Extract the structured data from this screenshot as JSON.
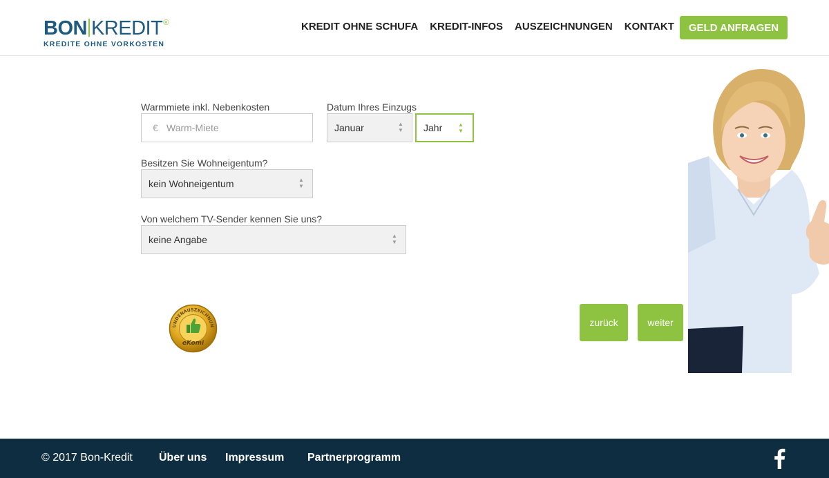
{
  "header": {
    "logo": {
      "bon": "BON",
      "kredit": "KREDIT",
      "registered": "®",
      "tagline": "KREDITE OHNE VORKOSTEN"
    },
    "nav": [
      {
        "label": "KREDIT OHNE SCHUFA"
      },
      {
        "label": "KREDIT-INFOS"
      },
      {
        "label": "AUSZEICHNUNGEN"
      },
      {
        "label": "KONTAKT"
      }
    ],
    "cta": "GELD ANFRAGEN"
  },
  "form": {
    "warmmiete": {
      "label": "Warmmiete inkl. Nebenkosten",
      "currency": "€",
      "placeholder": "Warm-Miete",
      "value": ""
    },
    "einzug": {
      "label": "Datum Ihres Einzugs",
      "month": "Januar",
      "year": "Jahr"
    },
    "eigentum": {
      "label": "Besitzen Sie Wohneigentum?",
      "value": "kein Wohneigentum"
    },
    "tv": {
      "label": "Von welchem TV-Sender kennen Sie uns?",
      "value": "keine Angabe"
    },
    "back": "zurück",
    "next": "weiter"
  },
  "badge": {
    "top_text": "KUNDENAUSZEICHNUNG",
    "bottom_text": "eKomi"
  },
  "footer": {
    "copyright": "© 2017 Bon-Kredit",
    "links": [
      {
        "label": "Über uns"
      },
      {
        "label": "Impressum"
      },
      {
        "label": "Partnerprogramm"
      }
    ],
    "social_icon": "facebook-icon"
  },
  "colors": {
    "accent": "#8dc340",
    "brand": "#1d5a7e",
    "footer_bg": "#0e2d40"
  }
}
